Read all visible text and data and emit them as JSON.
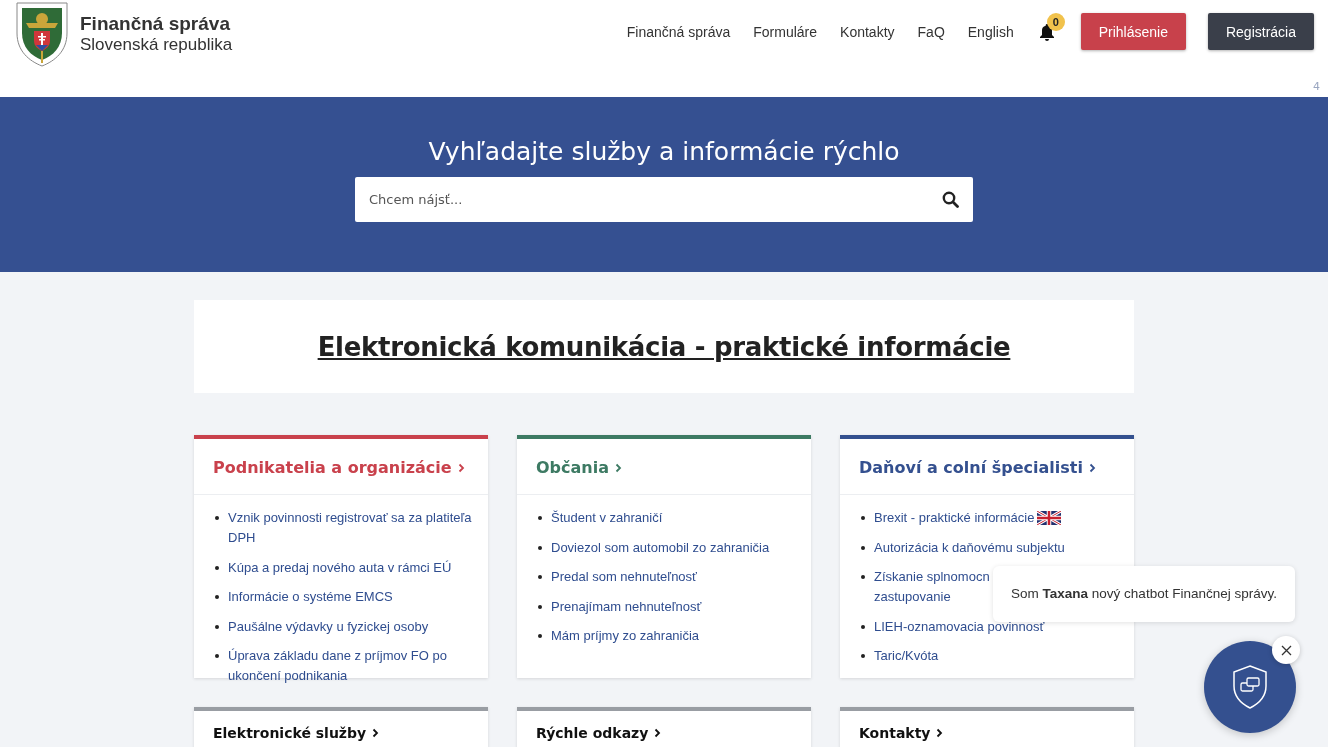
{
  "header": {
    "brand_title": "Finančná správa",
    "brand_subtitle": "Slovenská republika",
    "nav": [
      "Finančná správa",
      "Formuláre",
      "Kontakty",
      "FaQ",
      "English"
    ],
    "notifications": {
      "count": "0"
    },
    "buttons": [
      {
        "label": "Prihlásenie",
        "kind": "primary"
      },
      {
        "label": "Registrácia",
        "kind": "secondary"
      }
    ],
    "corner_mark": "4"
  },
  "hero": {
    "title": "Vyhľadajte služby a informácie rýchlo",
    "search": {
      "placeholder": "Chcem nájsť..."
    }
  },
  "banner": {
    "title": "Elektronická komunikácia - praktické informácie"
  },
  "cards": [
    {
      "title": "Podnikatelia a organizácie",
      "color": "#c9414c",
      "items": [
        {
          "text": "Vznik povinnosti registrovať sa za platiteľa DPH"
        },
        {
          "text": "Kúpa a predaj nového auta v rámci EÚ"
        },
        {
          "text": "Informácie o systéme EMCS"
        },
        {
          "text": "Paušálne výdavky u fyzickej osoby"
        },
        {
          "text": "Úprava základu dane z príjmov FO po ukončení podnikania"
        }
      ]
    },
    {
      "title": "Občania",
      "color": "#3d7a63",
      "items": [
        {
          "text": "Študent v zahraničí"
        },
        {
          "text": "Doviezol som automobil zo zahraničia"
        },
        {
          "text": "Predal som nehnuteľnosť"
        },
        {
          "text": "Prenajímam nehnuteľnosť"
        },
        {
          "text": "Mám príjmy zo zahraničia"
        }
      ]
    },
    {
      "title": "Daňoví a colní špecialisti",
      "color": "#34508f",
      "items": [
        {
          "text": "Brexit - praktické informácie",
          "flag": true
        },
        {
          "text": "Autorizácia k daňovému subjektu"
        },
        {
          "text": "Získanie splnomocn",
          "continuation": "zastupovanie"
        },
        {
          "text": "LIEH-oznamovacia povinnosť"
        },
        {
          "text": "Taric/Kvóta"
        }
      ]
    },
    {
      "title": "Elektronické služby",
      "color": "#999da3"
    },
    {
      "title": "Rýchle odkazy",
      "color": "#999da3"
    },
    {
      "title": "Kontakty",
      "color": "#999da3"
    }
  ],
  "chatbot": {
    "message": "Som **Taxana** nový chatbot Finančnej správy."
  }
}
